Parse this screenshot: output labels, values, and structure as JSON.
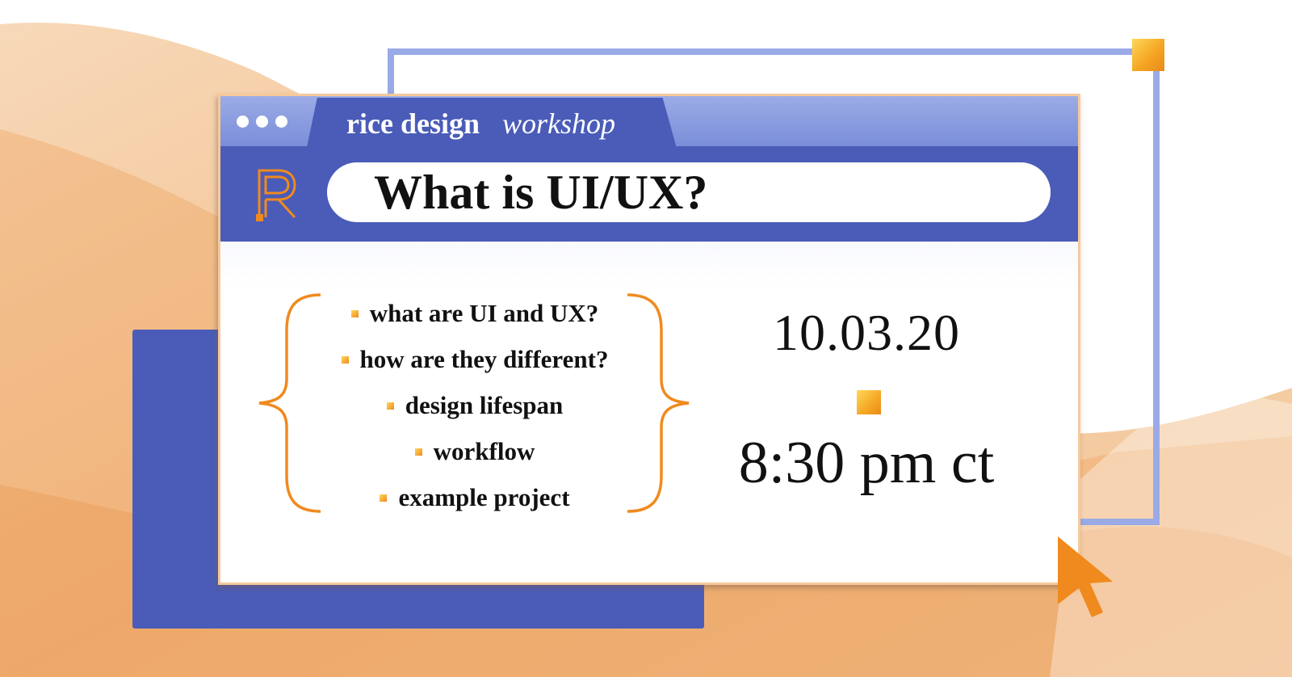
{
  "window": {
    "tab": {
      "title": "rice design",
      "subtitle": "workshop"
    },
    "address_bar": {
      "text": "What is UI/UX?"
    }
  },
  "agenda": {
    "items": [
      "what are UI and UX?",
      "how are they different?",
      "design lifespan",
      "workflow",
      "example project"
    ]
  },
  "event": {
    "date": "10.03.20",
    "time": "8:30 pm ct"
  },
  "colors": {
    "brand_blue": "#4a5cb8",
    "light_blue": "#9aaae6",
    "accent_orange": "#f08a1e",
    "background_wash": "#f3c596"
  },
  "icons": {
    "window_controls": "three-dots-icon",
    "logo": "r-logo-icon",
    "pointer": "cursor-arrow-icon",
    "agenda_brackets": "curly-brace-icon"
  }
}
